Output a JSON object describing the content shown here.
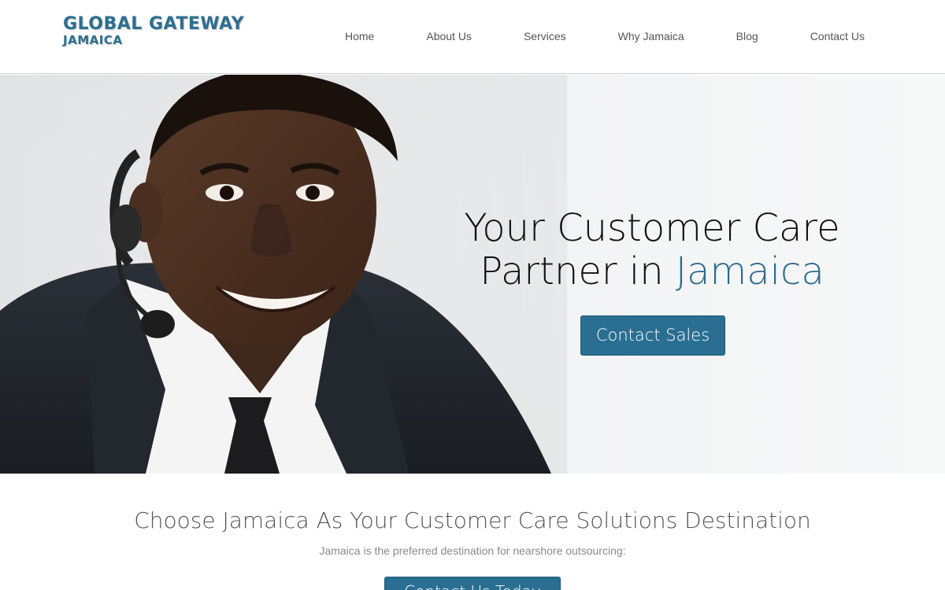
{
  "brand": {
    "name_line1": "GLOBAL GATEWAY",
    "name_line2": "JAMAICA",
    "color": "#2d6f91"
  },
  "nav": {
    "items": [
      {
        "label": "Home"
      },
      {
        "label": "About Us"
      },
      {
        "label": "Services"
      },
      {
        "label": "Why Jamaica"
      },
      {
        "label": "Blog"
      },
      {
        "label": "Contact Us"
      }
    ]
  },
  "hero": {
    "heading_line1": "Your Customer Care",
    "heading_line2_prefix": "Partner in ",
    "heading_line2_accent": "Jamaica",
    "cta_label": "Contact Sales",
    "accent_color": "#2c6a8f",
    "image": "smiling-call-center-agent-with-headset"
  },
  "intro": {
    "title": "Choose Jamaica As Your Customer Care Solutions Destination",
    "subtitle": "Jamaica is the preferred destination for nearshore outsourcing:",
    "cta_label": "Contact Us Today"
  },
  "colors": {
    "button": "#2a6f92"
  }
}
